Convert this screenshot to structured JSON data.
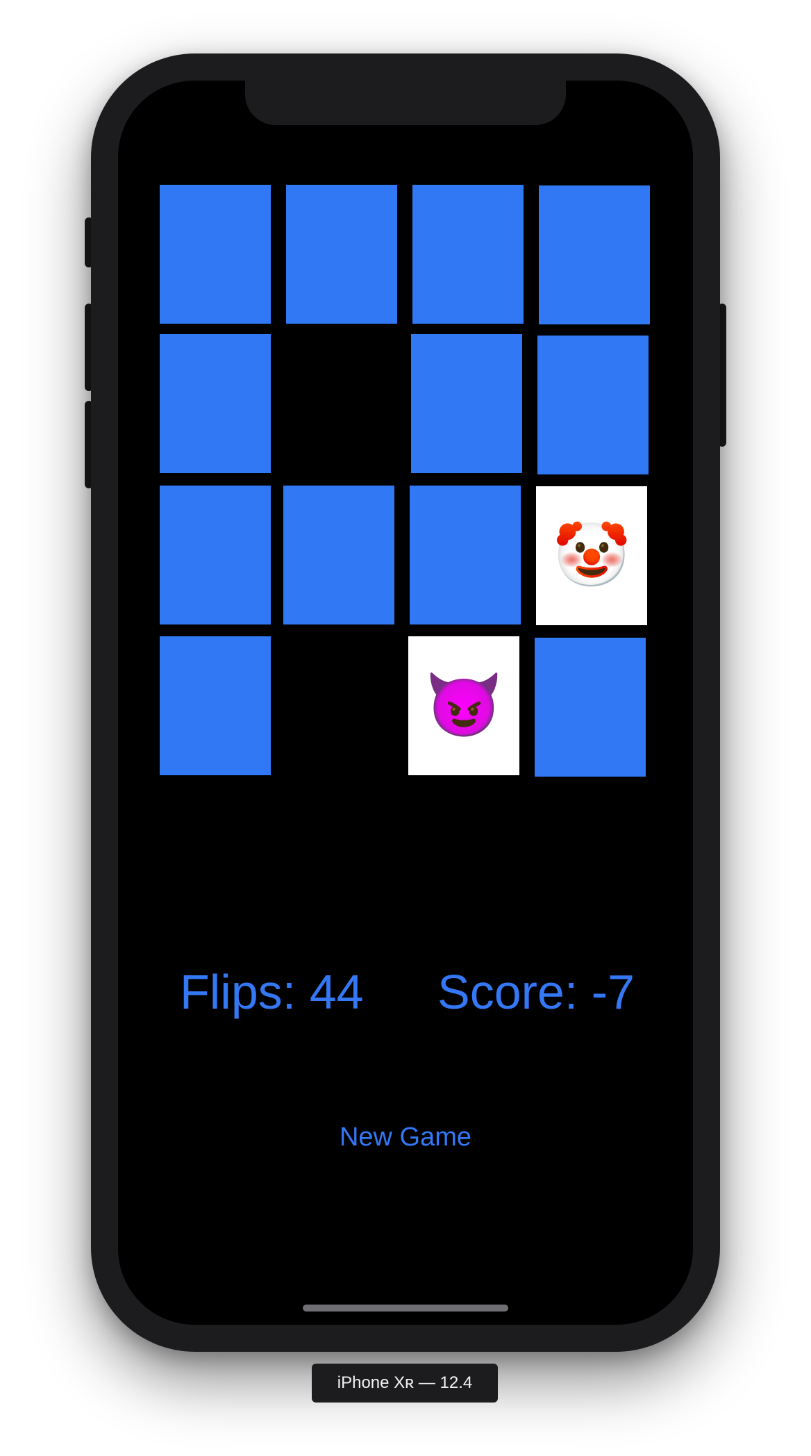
{
  "game": {
    "flips_label": "Flips: 44",
    "score_label": "Score: -7",
    "new_game_label": "New Game"
  },
  "cards": [
    {
      "state": "face-down",
      "emoji": ""
    },
    {
      "state": "face-down",
      "emoji": ""
    },
    {
      "state": "face-down",
      "emoji": ""
    },
    {
      "state": "face-down",
      "emoji": ""
    },
    {
      "state": "face-down",
      "emoji": ""
    },
    {
      "state": "matched",
      "emoji": ""
    },
    {
      "state": "face-down",
      "emoji": ""
    },
    {
      "state": "face-down",
      "emoji": ""
    },
    {
      "state": "face-down",
      "emoji": ""
    },
    {
      "state": "face-down",
      "emoji": ""
    },
    {
      "state": "face-down",
      "emoji": ""
    },
    {
      "state": "face-up",
      "emoji": "🤡"
    },
    {
      "state": "face-down",
      "emoji": ""
    },
    {
      "state": "matched",
      "emoji": ""
    },
    {
      "state": "face-up",
      "emoji": "😈"
    },
    {
      "state": "face-down",
      "emoji": ""
    }
  ],
  "colors": {
    "card_back": "#3178f4",
    "card_face": "#ffffff",
    "accent": "#3478f6",
    "screen_background": "#000000"
  },
  "simulator": {
    "device_label": "iPhone Xʀ — 12.4"
  }
}
